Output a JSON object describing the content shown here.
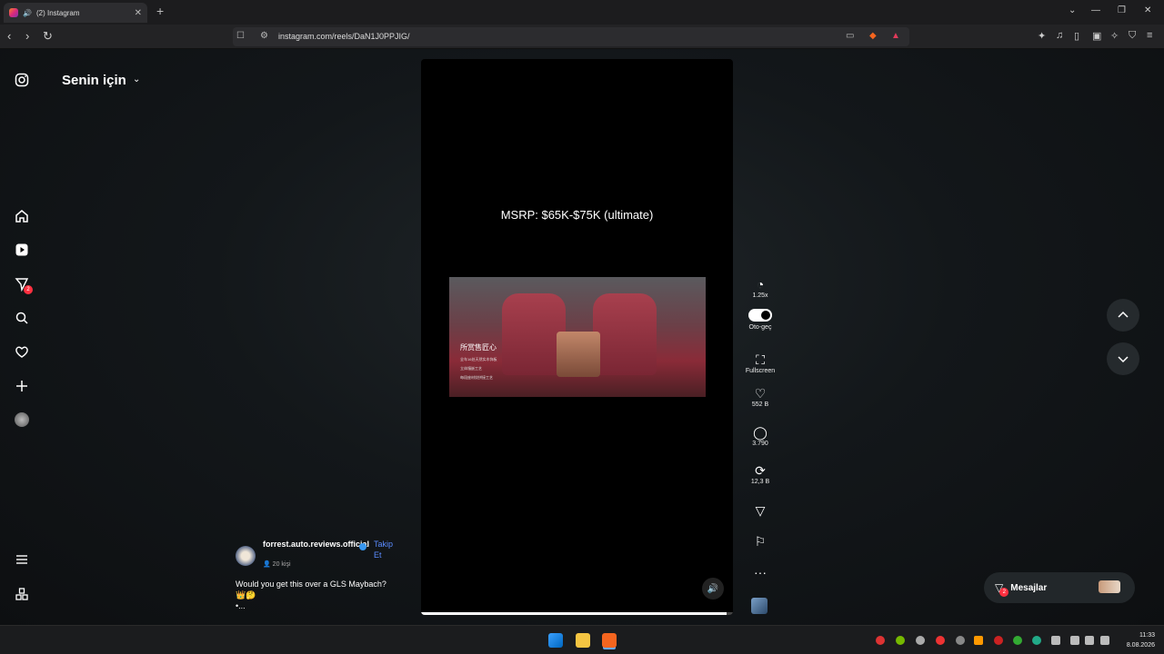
{
  "browser": {
    "tab_title": "(2) Instagram",
    "url": "instagram.com/reels/DaN1J0PPJIG/",
    "new_tab": "+",
    "tab_close": "✕"
  },
  "sidebar": {
    "feed_title": "Senin için",
    "badge_count": "2"
  },
  "reel": {
    "caption_overlay": "MSRP: $65K-$75K (ultimate)",
    "car_text_big": "所赏售匠心",
    "car_text_line1": "全车16处天然实木饰板",
    "car_text_line2": "立体镶嵌工艺",
    "car_text_line3": "每段座材纹拼接工艺",
    "progress": 0.98
  },
  "actions": {
    "speed": "1.25x",
    "autoplay": "Oto-geç",
    "fullscreen": "Fullscreen",
    "likes": "552 B",
    "comments": "3.790",
    "reposts": "12,3 B"
  },
  "author": {
    "username": "forrest.auto.reviews.official",
    "follow": "Takip Et",
    "people": "20 kişi",
    "caption": "Would you get this over a GLS Maybach?",
    "caption_emoji": "👑🤔",
    "more": "•..."
  },
  "messages": {
    "label": "Mesajlar",
    "badge": "2"
  },
  "taskbar": {
    "time": "11:33",
    "date": "8.08.2026"
  },
  "colors": {
    "accent_blue": "#5b8cff",
    "badge_red": "#ff3040"
  }
}
